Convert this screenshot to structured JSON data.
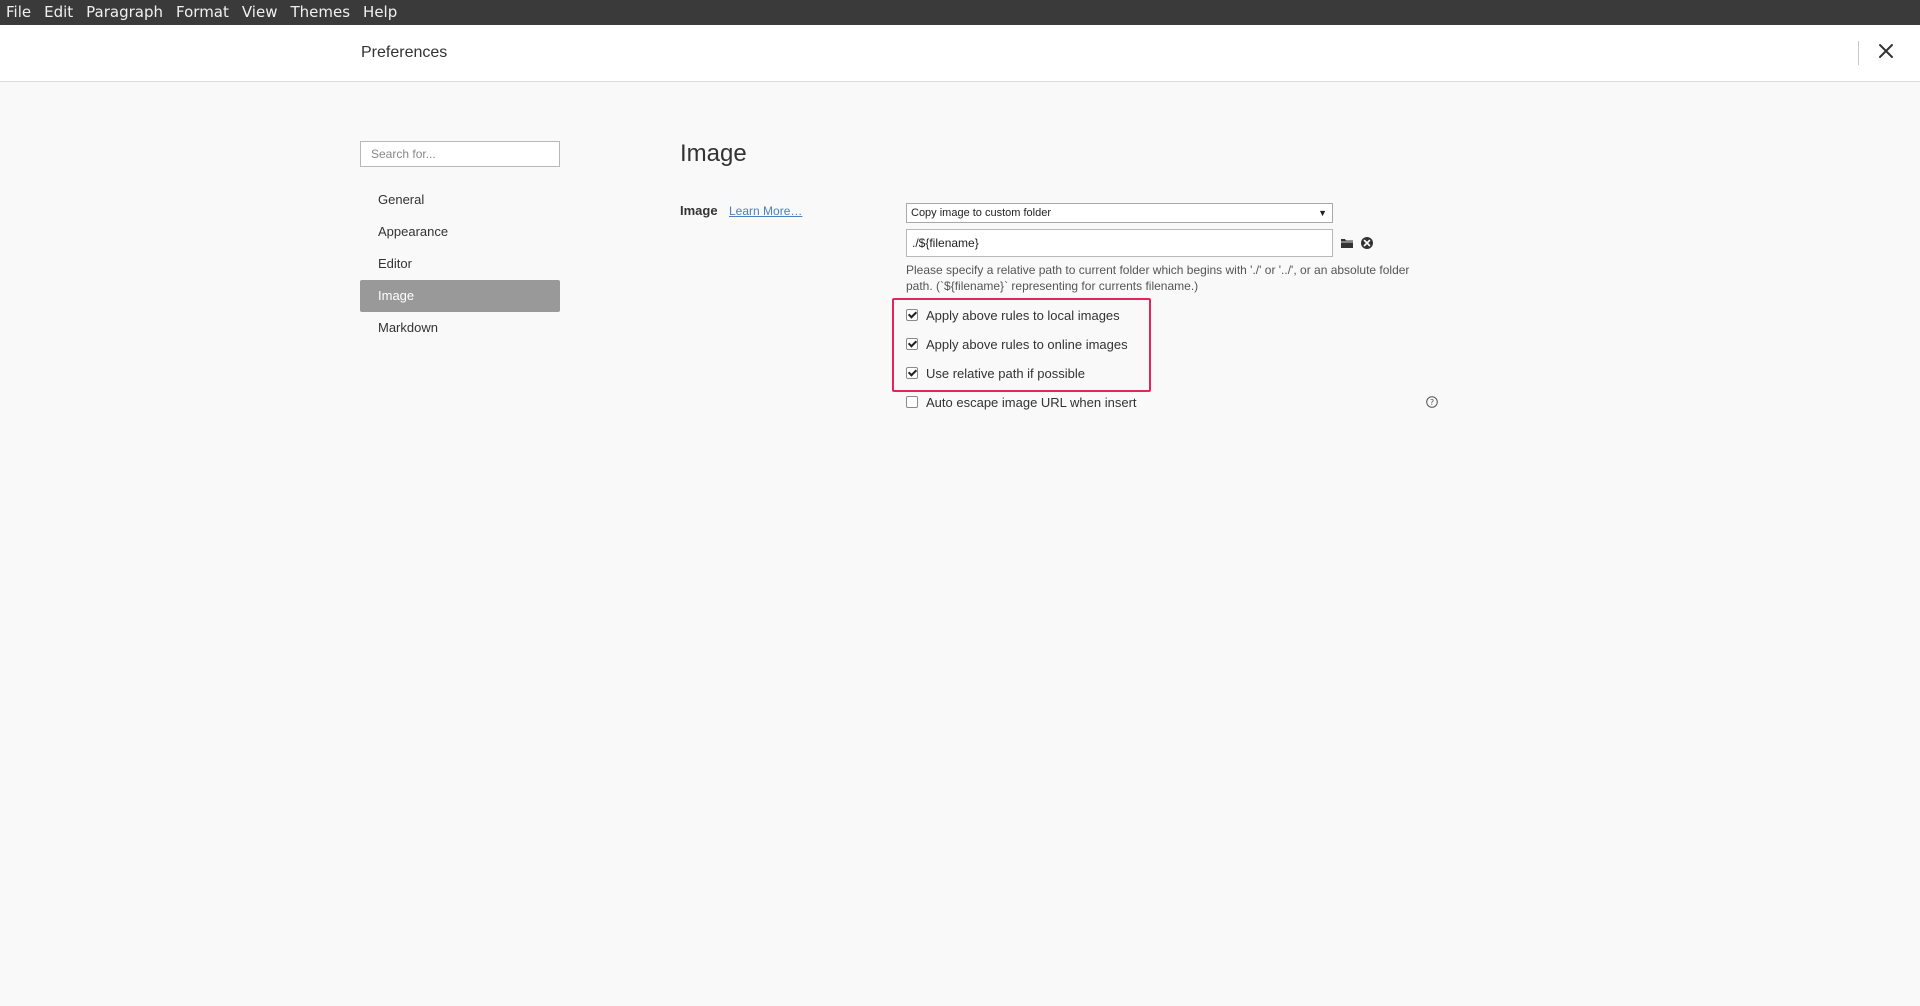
{
  "menubar": {
    "items": [
      "File",
      "Edit",
      "Paragraph",
      "Format",
      "View",
      "Themes",
      "Help"
    ]
  },
  "header": {
    "title": "Preferences",
    "close_icon": "close-icon"
  },
  "sidebar": {
    "search_placeholder": "Search for...",
    "items": [
      {
        "label": "General",
        "active": false
      },
      {
        "label": "Appearance",
        "active": false
      },
      {
        "label": "Editor",
        "active": false
      },
      {
        "label": "Image",
        "active": true
      },
      {
        "label": "Markdown",
        "active": false
      }
    ]
  },
  "main": {
    "section_title": "Image",
    "image_row": {
      "label": "Image",
      "learn_more": "Learn More…",
      "select_value": "Copy image to custom folder",
      "path_value": "./${filename}",
      "folder_icon": "folder-icon",
      "clear_icon": "clear-icon",
      "help_text": " Please specify a relative path to current folder which begins with './' or '../', or an absolute folder path. (`${filename}` representing for currents filename.)"
    },
    "options": [
      {
        "label": "Apply above rules to local images",
        "checked": true
      },
      {
        "label": "Apply above rules to online images",
        "checked": true
      },
      {
        "label": "Use relative path if possible",
        "checked": true
      },
      {
        "label": "Auto escape image URL when insert",
        "checked": false
      }
    ],
    "help_icon": "help-circle-icon",
    "highlight_color": "#e6245a"
  },
  "colors": {
    "menubar_bg": "#3a3a3a",
    "active_item_bg": "#999999",
    "link": "#4a7fc1",
    "page_bg": "#f9f9f9"
  }
}
